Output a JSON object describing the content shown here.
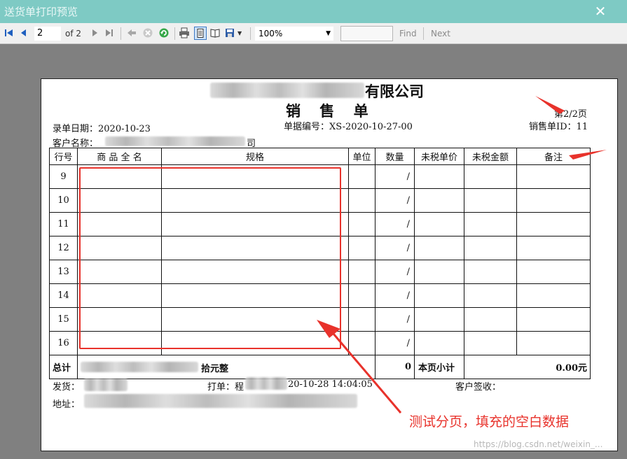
{
  "window": {
    "title": "送货单打印预览",
    "close": "✕"
  },
  "toolbar": {
    "page_current": "2",
    "page_of": "of 2",
    "zoom": "100%",
    "find_value": "",
    "find_label": "Find",
    "next_label": "Next"
  },
  "report": {
    "company_suffix": "有限公司",
    "title": "销 售 单",
    "page_info": "第2/2页",
    "entry_date": "录单日期：2020-10-23",
    "doc_no": "单据编号：XS-2020-10-27-00",
    "sales_id": "销售单ID：11",
    "customer_label": "客户名称：",
    "customer_suffix": "司",
    "columns": [
      "行号",
      "商 品 全 名",
      "规格",
      "单位",
      "数量",
      "未税单价",
      "未税金额",
      "备注"
    ],
    "rows": [
      {
        "no": "9",
        "qty": "/"
      },
      {
        "no": "10",
        "qty": "/"
      },
      {
        "no": "11",
        "qty": "/"
      },
      {
        "no": "12",
        "qty": "/"
      },
      {
        "no": "13",
        "qty": "/"
      },
      {
        "no": "14",
        "qty": "/"
      },
      {
        "no": "15",
        "qty": "/"
      },
      {
        "no": "16",
        "qty": "/"
      }
    ],
    "total_label": "总计",
    "total_amount_text": "拾元整",
    "total_qty": "0",
    "page_subtotal_label": "本页小计",
    "page_subtotal_value": "0.00元",
    "ship_label": "发货：",
    "print_label": "打单：程",
    "print_time": "20-10-28 14:04:05",
    "customer_sign": "客户签收：",
    "address_label": "地址："
  },
  "annotation": {
    "text": "测试分页，填充的空白数据",
    "color": "#e8322b"
  },
  "watermark": "https://blog.csdn.net/weixin_..."
}
